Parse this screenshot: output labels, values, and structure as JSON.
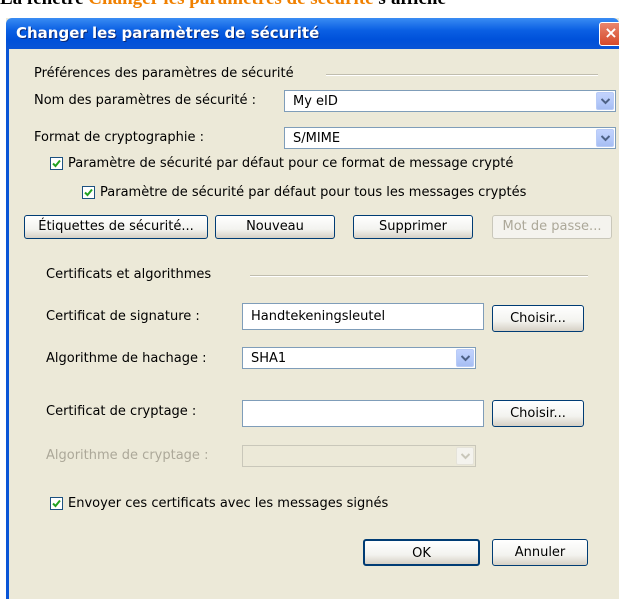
{
  "caption": {
    "prefix": "La fenêtre ",
    "highlight": "Changer les paramètres de sécurité",
    "suffix": " s'affiche"
  },
  "dialog": {
    "title": "Changer les paramètres de sécurité",
    "close": "×"
  },
  "prefs": {
    "group_label": "Préférences des paramètres de sécurité",
    "name_label": "Nom des paramètres de sécurité :",
    "name_value": "My eID",
    "crypto_label": "Format de cryptographie :",
    "crypto_value": "S/MIME",
    "default_format_label": "Paramètre de sécurité par défaut pour ce format de message crypté",
    "default_format_checked": true,
    "default_all_label": "Paramètre de sécurité par défaut pour tous les messages cryptés",
    "default_all_checked": true
  },
  "buttons": {
    "labels": "Étiquettes de sécurité...",
    "new": "Nouveau",
    "delete": "Supprimer",
    "password": "Mot de passe..."
  },
  "certs": {
    "group_label": "Certificats et algorithmes",
    "signing_label": "Certificat de signature :",
    "signing_value": "Handtekeningsleutel",
    "choose1": "Choisir...",
    "hash_label": "Algorithme de hachage :",
    "hash_value": "SHA1",
    "encrypt_label": "Certificat de cryptage :",
    "encrypt_value": "",
    "choose2": "Choisir...",
    "enc_algo_label": "Algorithme de cryptage :",
    "enc_algo_value": "",
    "send_label": "Envoyer ces certificats avec les messages signés",
    "send_checked": true
  },
  "footer": {
    "ok": "OK",
    "cancel": "Annuler"
  }
}
